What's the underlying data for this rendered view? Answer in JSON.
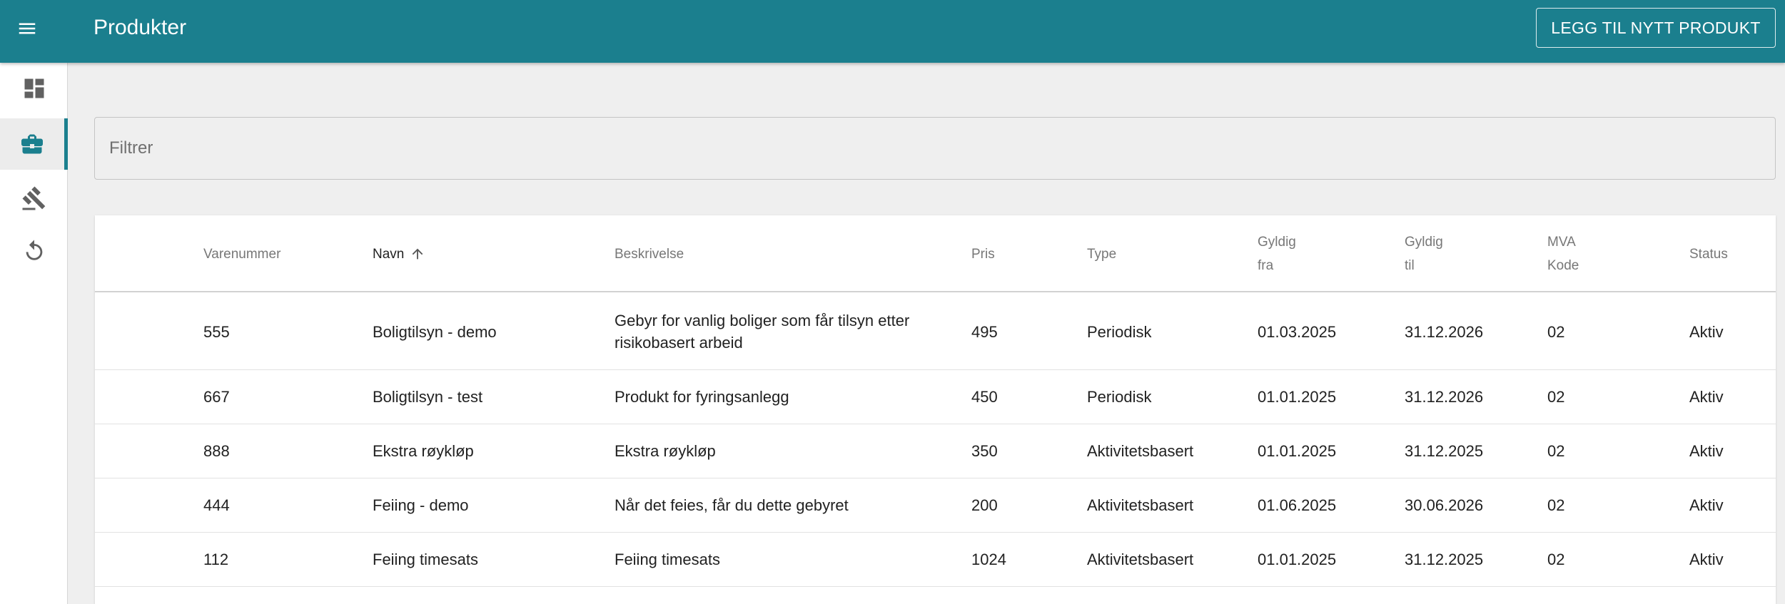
{
  "header": {
    "title": "Produkter",
    "add_button_label": "LEGG TIL NYTT PRODUKT",
    "menu_icon": "hamburger-menu-icon"
  },
  "colors": {
    "primary": "#1b7f8e",
    "background": "#efefef"
  },
  "sidebar": {
    "items": [
      {
        "icon": "dashboard-icon",
        "active": false
      },
      {
        "icon": "briefcase-icon",
        "active": true
      },
      {
        "icon": "gavel-icon",
        "active": false
      },
      {
        "icon": "history-icon",
        "active": false
      }
    ]
  },
  "filter": {
    "placeholder": "Filtrer"
  },
  "table": {
    "headers": {
      "varenummer": "Varenummer",
      "navn": "Navn",
      "beskrivelse": "Beskrivelse",
      "pris": "Pris",
      "type": "Type",
      "gyldig_fra_1": "Gyldig",
      "gyldig_fra_2": "fra",
      "gyldig_til_1": "Gyldig",
      "gyldig_til_2": "til",
      "mva_1": "MVA",
      "mva_2": "Kode",
      "status": "Status"
    },
    "sort": {
      "column": "Navn",
      "direction": "ascending"
    },
    "rows": [
      {
        "varenummer": "555",
        "navn": "Boligtilsyn - demo",
        "beskrivelse": "Gebyr for vanlig boliger som får tilsyn etter risikobasert arbeid",
        "pris": "495",
        "type": "Periodisk",
        "gyldig_fra": "01.03.2025",
        "gyldig_til": "31.12.2026",
        "mva": "02",
        "status": "Aktiv"
      },
      {
        "varenummer": "667",
        "navn": "Boligtilsyn - test",
        "beskrivelse": "Produkt for fyringsanlegg",
        "pris": "450",
        "type": "Periodisk",
        "gyldig_fra": "01.01.2025",
        "gyldig_til": "31.12.2026",
        "mva": "02",
        "status": "Aktiv"
      },
      {
        "varenummer": "888",
        "navn": "Ekstra røykløp",
        "beskrivelse": "Ekstra røykløp",
        "pris": "350",
        "type": "Aktivitetsbasert",
        "gyldig_fra": "01.01.2025",
        "gyldig_til": "31.12.2025",
        "mva": "02",
        "status": "Aktiv"
      },
      {
        "varenummer": "444",
        "navn": "Feiing - demo",
        "beskrivelse": "Når det feies, får du dette gebyret",
        "pris": "200",
        "type": "Aktivitetsbasert",
        "gyldig_fra": "01.06.2025",
        "gyldig_til": "30.06.2026",
        "mva": "02",
        "status": "Aktiv"
      },
      {
        "varenummer": "112",
        "navn": "Feiing timesats",
        "beskrivelse": "Feiing timesats",
        "pris": "1024",
        "type": "Aktivitetsbasert",
        "gyldig_fra": "01.01.2025",
        "gyldig_til": "31.12.2025",
        "mva": "02",
        "status": "Aktiv"
      }
    ]
  }
}
